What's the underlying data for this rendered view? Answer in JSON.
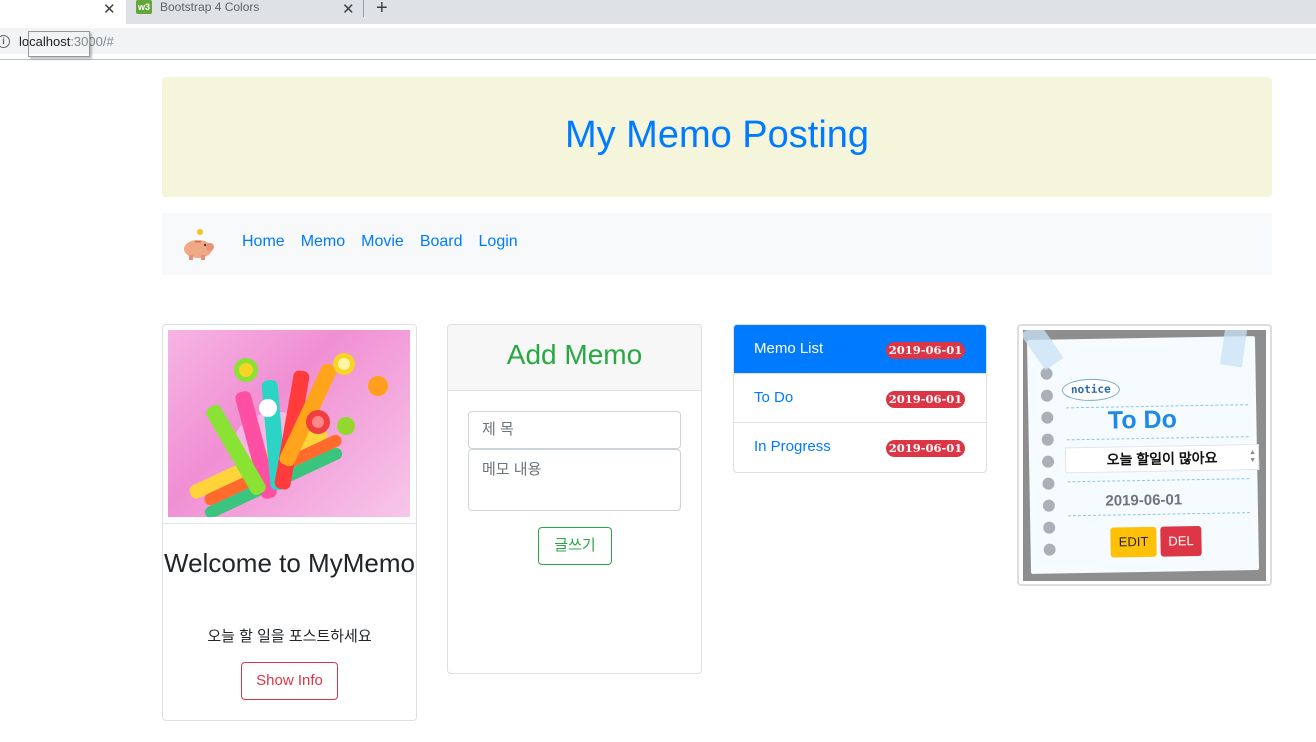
{
  "browser": {
    "tab1_close": "✕",
    "tab2_title": "Bootstrap 4 Colors",
    "tab2_close": "✕",
    "new_tab": "+",
    "url_host": "localhost",
    "url_rest": ":3000/#"
  },
  "header": {
    "title": "My Memo Posting"
  },
  "nav": {
    "logo_icon": "piggy-bank-icon",
    "items": [
      {
        "label": "Home"
      },
      {
        "label": "Memo"
      },
      {
        "label": "Movie"
      },
      {
        "label": "Board"
      },
      {
        "label": "Login"
      }
    ]
  },
  "welcome": {
    "title": "Welcome to MyMemo",
    "subtitle": "오늘 할 일을 포스트하세요",
    "button": "Show Info"
  },
  "add_memo": {
    "title": "Add Memo",
    "title_placeholder": "제  목",
    "body_placeholder": "메모 내용",
    "submit": "글쓰기"
  },
  "memo_list": {
    "items": [
      {
        "label": "Memo List",
        "date": "2019-06-01",
        "active": true
      },
      {
        "label": "To Do",
        "date": "2019-06-01",
        "active": false
      },
      {
        "label": "In Progress",
        "date": "2019-06-01",
        "active": false
      }
    ]
  },
  "notice_card": {
    "badge": "notice",
    "title": "To Do",
    "content": "오늘  할일이  많아요",
    "date": "2019-06-01",
    "edit": "EDIT",
    "delete": "DEL"
  },
  "colors": {
    "primary": "#007bff",
    "success": "#28a745",
    "danger": "#dc3545",
    "warning": "#ffc107",
    "jumbotron": "#f5f5dc"
  }
}
